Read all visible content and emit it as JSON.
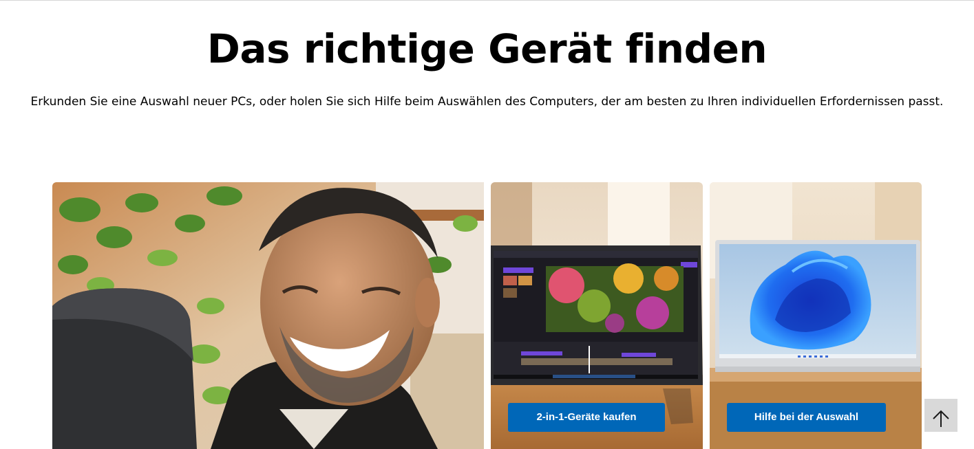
{
  "hero": {
    "title": "Das richtige Gerät finden",
    "subtitle": "Erkunden Sie eine Auswahl neuer PCs, oder holen Sie sich Hilfe beim Auswählen des Computers, der am besten zu Ihren individuellen Erfordernissen passt."
  },
  "cards": [
    {
      "name": "man-at-laptop-photo"
    },
    {
      "name": "2-in-1-laptop-photo",
      "button_label": "2-in-1-Geräte kaufen"
    },
    {
      "name": "laptop-windows-bloom-photo",
      "button_label": "Hilfe bei der Auswahl"
    }
  ],
  "colors": {
    "button": "#0067b8",
    "back_to_top_bg": "#d9d9d9",
    "background": "#ffffff"
  },
  "icons": {
    "back_to_top": "arrow-up-icon"
  }
}
